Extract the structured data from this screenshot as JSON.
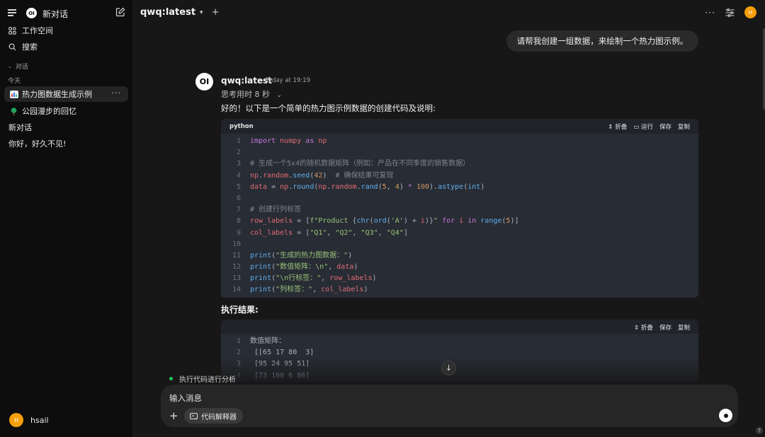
{
  "sidebar": {
    "new_chat": "新对话",
    "items": [
      {
        "label": "工作空间",
        "icon": "workspace-icon"
      },
      {
        "label": "搜索",
        "icon": "search-icon"
      }
    ],
    "section_chats": "对话",
    "section_today": "今天",
    "chats": [
      {
        "label": "热力图数据生成示例",
        "active": true
      },
      {
        "label": "公园漫步的回忆",
        "active": false
      },
      {
        "label": "新对话",
        "active": false
      },
      {
        "label": "你好，好久不见!",
        "active": false
      }
    ],
    "more": "···",
    "user": {
      "initial": "H",
      "name": "hsail"
    }
  },
  "header": {
    "model": "qwq:latest",
    "more": "···",
    "avatar_initial": "H"
  },
  "chat": {
    "user_message": "请帮我创建一组数据，来绘制一个热力图示例。",
    "bot_name": "qwq:latest",
    "bot_time": "Today at 19:19",
    "think": "思考用时 8 秒",
    "answer": "好的！以下是一个简单的热力图示例数据的创建代码及说明:",
    "code_block": {
      "lang": "python",
      "actions": [
        "折叠",
        "运行",
        "保存",
        "复制"
      ]
    },
    "exec_title": "执行结果:",
    "output_block": {
      "actions": [
        "折叠",
        "保存",
        "复制"
      ]
    },
    "analyzing": "执行代码进行分析"
  },
  "composer": {
    "placeholder": "输入消息",
    "tool_chip": "代码解释器"
  },
  "colors": {
    "accent_avatar": "#f59e0b",
    "status_dot": "#22c55e"
  }
}
